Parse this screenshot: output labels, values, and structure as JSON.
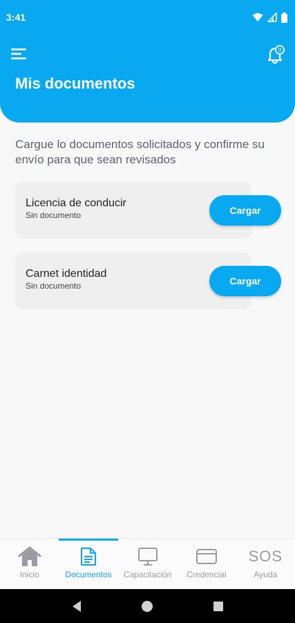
{
  "status_bar": {
    "time": "3:41"
  },
  "header": {
    "title": "Mis documentos",
    "notification_badge": "0"
  },
  "intro_text": "Cargue lo documentos solicitados y confirme su envío para que sean revisados",
  "documents": [
    {
      "name": "Licencia de conducir",
      "status": "Sin documento",
      "button_label": "Cargar"
    },
    {
      "name": "Carnet identidad",
      "status": "Sin documento",
      "button_label": "Cargar"
    }
  ],
  "bottom_nav": {
    "items": [
      {
        "label": "Inicio",
        "icon": "home-icon"
      },
      {
        "label": "Documentos",
        "icon": "document-icon",
        "active": true
      },
      {
        "label": "Capacitación",
        "icon": "monitor-icon"
      },
      {
        "label": "Credencial",
        "icon": "card-icon"
      },
      {
        "label": "Ayuda",
        "icon": "sos-icon",
        "icon_text": "SOS"
      }
    ]
  },
  "colors": {
    "accent": "#08a9f0",
    "card_bg": "#efefef",
    "inactive": "#9a9aa2"
  }
}
